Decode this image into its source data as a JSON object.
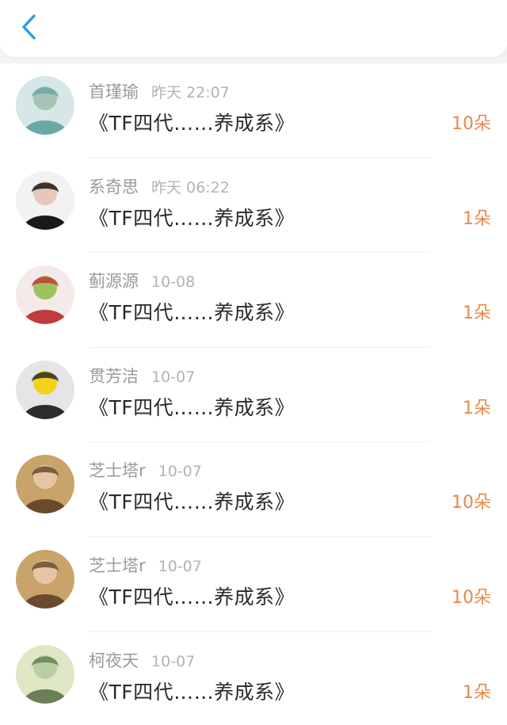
{
  "header": {
    "back_icon": "chevron-left-icon",
    "accent": "#2e9be6"
  },
  "items": [
    {
      "name": "首瑾瑜",
      "time": "昨天 22:07",
      "title": "《TF四代……养成系》",
      "count": "10朵",
      "avatar_palette": [
        "#d7e6e6",
        "#6aa8a8",
        "#a7c3b6"
      ]
    },
    {
      "name": "系奇思",
      "time": "昨天 06:22",
      "title": "《TF四代……养成系》",
      "count": "1朵",
      "avatar_palette": [
        "#f2f2f2",
        "#1a1a1a",
        "#e6c7b8"
      ]
    },
    {
      "name": "蓟源源",
      "time": "10-08",
      "title": "《TF四代……养成系》",
      "count": "1朵",
      "avatar_palette": [
        "#f5eaea",
        "#c03b3b",
        "#9cc35a"
      ]
    },
    {
      "name": "贯芳洁",
      "time": "10-07",
      "title": "《TF四代……养成系》",
      "count": "1朵",
      "avatar_palette": [
        "#e5e5e5",
        "#2c2c2c",
        "#f2d21b"
      ]
    },
    {
      "name": "芝士塔r",
      "time": "10-07",
      "title": "《TF四代……养成系》",
      "count": "10朵",
      "avatar_palette": [
        "#c8a36a",
        "#6a4a2a",
        "#e4c6a6"
      ]
    },
    {
      "name": "芝士塔r",
      "time": "10-07",
      "title": "《TF四代……养成系》",
      "count": "10朵",
      "avatar_palette": [
        "#c8a36a",
        "#6a4a2a",
        "#e4c6a6"
      ]
    },
    {
      "name": "柯夜天",
      "time": "10-07",
      "title": "《TF四代……养成系》",
      "count": "1朵",
      "avatar_palette": [
        "#dfe7c6",
        "#6b7f56",
        "#b8cfa1"
      ]
    }
  ],
  "colors": {
    "count": "#e8894a",
    "name": "#9a9a9a",
    "time": "#b3b3b3",
    "title": "#2a2a2a"
  }
}
